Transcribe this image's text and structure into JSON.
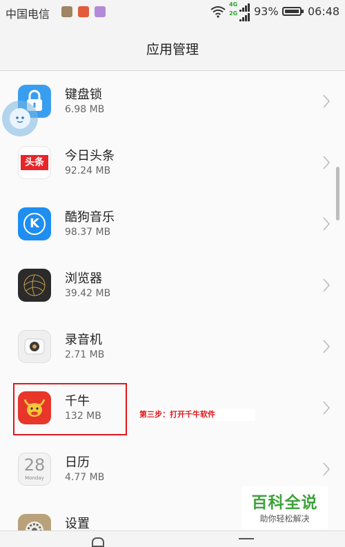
{
  "status_bar": {
    "carrier": "中国电信",
    "network_top": "4G",
    "network_bottom": "2G",
    "battery": "93%",
    "time": "06:48"
  },
  "header": {
    "title": "应用管理"
  },
  "apps": [
    {
      "name": "键盘锁",
      "size": "6.98 MB",
      "icon": "lock-icon",
      "color": "#3a9ef0"
    },
    {
      "name": "今日头条",
      "size": "92.24 MB",
      "icon": "toutiao-icon",
      "badge": "头条",
      "color": "#e8262a"
    },
    {
      "name": "酷狗音乐",
      "size": "98.37 MB",
      "icon": "kugou-icon",
      "badge": "K",
      "color": "#1e8ef0"
    },
    {
      "name": "浏览器",
      "size": "39.42 MB",
      "icon": "browser-icon",
      "color": "#2b2b2b"
    },
    {
      "name": "录音机",
      "size": "2.71 MB",
      "icon": "recorder-icon",
      "color": "#eeeeee"
    },
    {
      "name": "千牛",
      "size": "132 MB",
      "icon": "qianniu-icon",
      "color": "#e8362a"
    },
    {
      "name": "日历",
      "size": "4.77 MB",
      "icon": "calendar-icon",
      "badge": "28",
      "badge_sub": "Monday",
      "color": "#ececec"
    },
    {
      "name": "设置",
      "size": "",
      "icon": "settings-icon",
      "color": "#b9a17a"
    }
  ],
  "annotation": {
    "step_text": "第三步：打开千牛软件",
    "color": "#e0161b"
  },
  "watermark": {
    "title": "百科全说",
    "subtitle": "助你轻松解决",
    "color": "#3ea23a"
  }
}
